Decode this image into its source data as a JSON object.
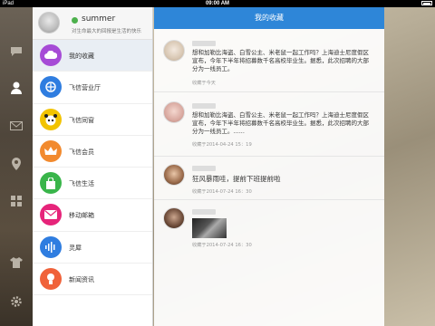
{
  "status_bar": {
    "device": "iPad",
    "time": "09:00 AM"
  },
  "profile": {
    "name": "summer",
    "signature": "对生命最大的回报是生活的快乐"
  },
  "menu": {
    "items": [
      {
        "label": "我的收藏",
        "icon": "cloud-icon",
        "color": "#a64bd6"
      },
      {
        "label": "飞信营业厅",
        "icon": "fetion-logo-icon",
        "color": "#2f7de0"
      },
      {
        "label": "飞信同窗",
        "icon": "panda-icon",
        "color": "#f2c300"
      },
      {
        "label": "飞信会员",
        "icon": "crown-icon",
        "color": "#f28a2e"
      },
      {
        "label": "飞信生活",
        "icon": "shopping-bag-icon",
        "color": "#39b54a"
      },
      {
        "label": "移动邮箱",
        "icon": "mail-icon",
        "color": "#e6247a"
      },
      {
        "label": "灵犀",
        "icon": "voice-wave-icon",
        "color": "#2f7de0"
      },
      {
        "label": "新闻资讯",
        "icon": "news-icon",
        "color": "#f0623a"
      }
    ]
  },
  "content": {
    "title": "我的收藏",
    "posts": [
      {
        "text": "想和加勒比海盗、白雪公主、米老鼠一起工作吗？上海迪士尼度假区宣布，今年下半年将招募数千名高校毕业生。据悉，此次招聘的大部分为一线员工。",
        "time": "收藏于今天"
      },
      {
        "text": "想和加勒比海盗、白雪公主、米老鼠一起工作吗？上海迪士尼度假区宣布，今年下半年将招募数千名高校毕业生。据悉，此次招聘的大部分为一线员工。......",
        "time": "收藏于2014-04-24 15：19"
      },
      {
        "text": "狂风暴雨哇，提前下班提前啦",
        "time": "收藏于2014-07-24 16：30"
      },
      {
        "text": "",
        "time": "收藏于2014-07-24 16：30"
      }
    ]
  },
  "rail": {
    "icons": [
      "chat-bubble-icon",
      "person-icon",
      "mail-icon",
      "location-pin-icon",
      "apps-grid-icon",
      "shirt-icon",
      "gear-icon"
    ]
  }
}
